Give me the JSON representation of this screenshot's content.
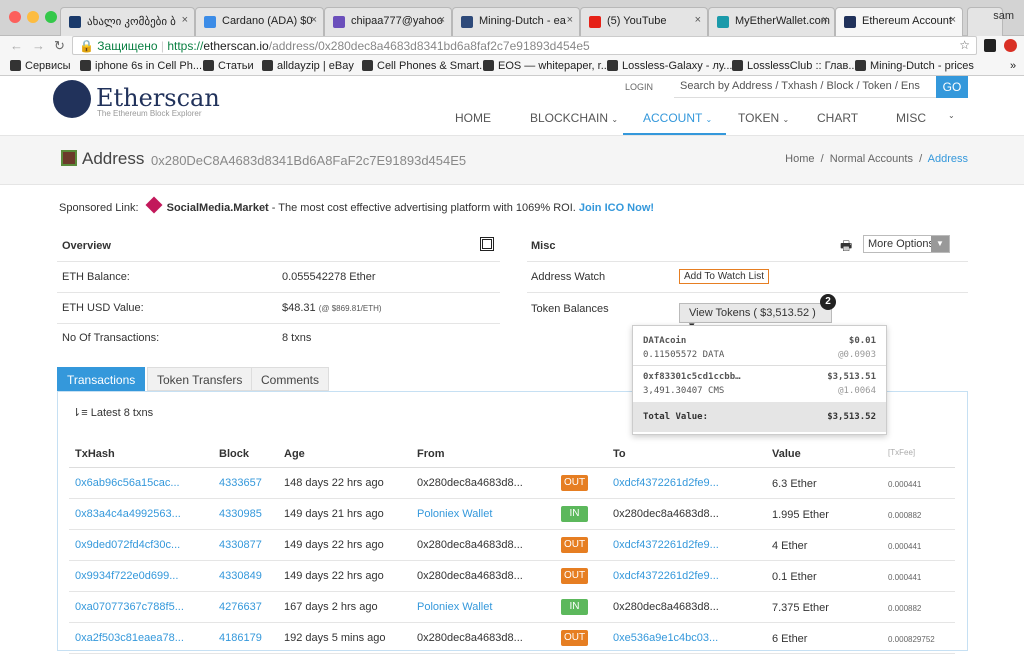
{
  "browser": {
    "tabs": [
      {
        "title": "ახალი კომბები ბ",
        "color": "#1a3a6b"
      },
      {
        "title": "Cardano (ADA) $0",
        "color": "#3c8ce7"
      },
      {
        "title": "chipaa777@yahoo",
        "color": "#6b4fbb"
      },
      {
        "title": "Mining-Dutch - ea",
        "color": "#2e4a7a"
      },
      {
        "title": "(5) YouTube",
        "color": "#e62117"
      },
      {
        "title": "MyEtherWallet.com",
        "color": "#1b9aaa"
      },
      {
        "title": "Ethereum Account",
        "color": "#21325b"
      }
    ],
    "profile": "sam",
    "secure_label": "Защищено",
    "url_scheme": "https://",
    "url_host": "etherscan.io",
    "url_path": "/address/0x280dec8a4683d8341bd6a8faf2c7e91893d454e5",
    "bookmarks": [
      "Сервисы",
      "iphone 6s in Cell Ph...",
      "Статьи",
      "alldayzip | eBay",
      "Cell Phones & Smart...",
      "EOS — whitepaper, r...",
      "Lossless-Galaxy - лу...",
      "LosslessClub :: Глав...",
      "Mining-Dutch - prices"
    ]
  },
  "site": {
    "logo": "Etherscan",
    "tagline": "The Ethereum Block Explorer",
    "login": "LOGIN",
    "search_placeholder": "Search by Address / Txhash / Block / Token / Ens",
    "go": "GO",
    "nav": [
      "HOME",
      "BLOCKCHAIN",
      "ACCOUNT",
      "TOKEN",
      "CHART",
      "MISC"
    ],
    "accent": "#3498db"
  },
  "banner": {
    "title": "Address",
    "address": "0x280DeC8A4683d8341Bd6A8FaF2c7E91893d454E5",
    "crumbs": [
      "Home",
      "Normal Accounts",
      "Address"
    ]
  },
  "sponsor": {
    "label": "Sponsored Link:",
    "name": "SocialMedia.Market",
    "text": " - The most cost effective advertising platform with 1069% ROI.",
    "cta": "Join ICO Now!"
  },
  "overview": {
    "title": "Overview",
    "rows": [
      {
        "k": "ETH Balance:",
        "v": "0.055542278 Ether"
      },
      {
        "k": "ETH USD Value:",
        "v": "$48.31",
        "sub": "(@ $869.81/ETH)"
      },
      {
        "k": "No Of Transactions:",
        "v": "8 txns"
      }
    ]
  },
  "misc": {
    "title": "Misc",
    "more": "More Options",
    "watch_label": "Address Watch",
    "watch_btn": "Add To Watch List",
    "tokens_label": "Token Balances",
    "tokens_btn": "View Tokens ( $3,513.52 )",
    "token_count": "2"
  },
  "tokens": [
    {
      "name": "DATAcoin",
      "amount": "0.11505572 DATA",
      "usd": "$0.01",
      "rate": "@0.0903"
    },
    {
      "name": "0xf83301c5cd1ccbb…",
      "amount": "3,491.30407 CMS",
      "usd": "$3,513.51",
      "rate": "@1.0064"
    }
  ],
  "tokens_total": {
    "label": "Total Value:",
    "value": "$3,513.52"
  },
  "tabs": [
    "Transactions",
    "Token Transfers",
    "Comments"
  ],
  "latest": "Latest 8 txns",
  "table": {
    "headers": [
      "TxHash",
      "Block",
      "Age",
      "From",
      "To",
      "Value",
      "[TxFee]"
    ],
    "rows": [
      {
        "hash": "0x6ab96c56a15cac...",
        "block": "4333657",
        "age": "148 days 22 hrs ago",
        "from": "0x280dec8a4683d8...",
        "from_link": false,
        "dir": "OUT",
        "to": "0xdcf4372261d2fe9...",
        "to_link": true,
        "value": "6.3 Ether",
        "fee": "0.000441"
      },
      {
        "hash": "0x83a4c4a4992563...",
        "block": "4330985",
        "age": "149 days 21 hrs ago",
        "from": "Poloniex Wallet",
        "from_link": true,
        "dir": "IN",
        "to": "0x280dec8a4683d8...",
        "to_link": false,
        "value": "1.995 Ether",
        "fee": "0.000882"
      },
      {
        "hash": "0x9ded072fd4cf30c...",
        "block": "4330877",
        "age": "149 days 22 hrs ago",
        "from": "0x280dec8a4683d8...",
        "from_link": false,
        "dir": "OUT",
        "to": "0xdcf4372261d2fe9...",
        "to_link": true,
        "value": "4 Ether",
        "fee": "0.000441"
      },
      {
        "hash": "0x9934f722e0d699...",
        "block": "4330849",
        "age": "149 days 22 hrs ago",
        "from": "0x280dec8a4683d8...",
        "from_link": false,
        "dir": "OUT",
        "to": "0xdcf4372261d2fe9...",
        "to_link": true,
        "value": "0.1 Ether",
        "fee": "0.000441"
      },
      {
        "hash": "0xa07077367c788f5...",
        "block": "4276637",
        "age": "167 days 2 hrs ago",
        "from": "Poloniex Wallet",
        "from_link": true,
        "dir": "IN",
        "to": "0x280dec8a4683d8...",
        "to_link": false,
        "value": "7.375 Ether",
        "fee": "0.000882"
      },
      {
        "hash": "0xa2f503c81eaea78...",
        "block": "4186179",
        "age": "192 days 5 mins ago",
        "from": "0x280dec8a4683d8...",
        "from_link": false,
        "dir": "OUT",
        "to": "0xe536a9e1c4bc03...",
        "to_link": true,
        "value": "6 Ether",
        "fee": "0.000829752"
      }
    ]
  }
}
